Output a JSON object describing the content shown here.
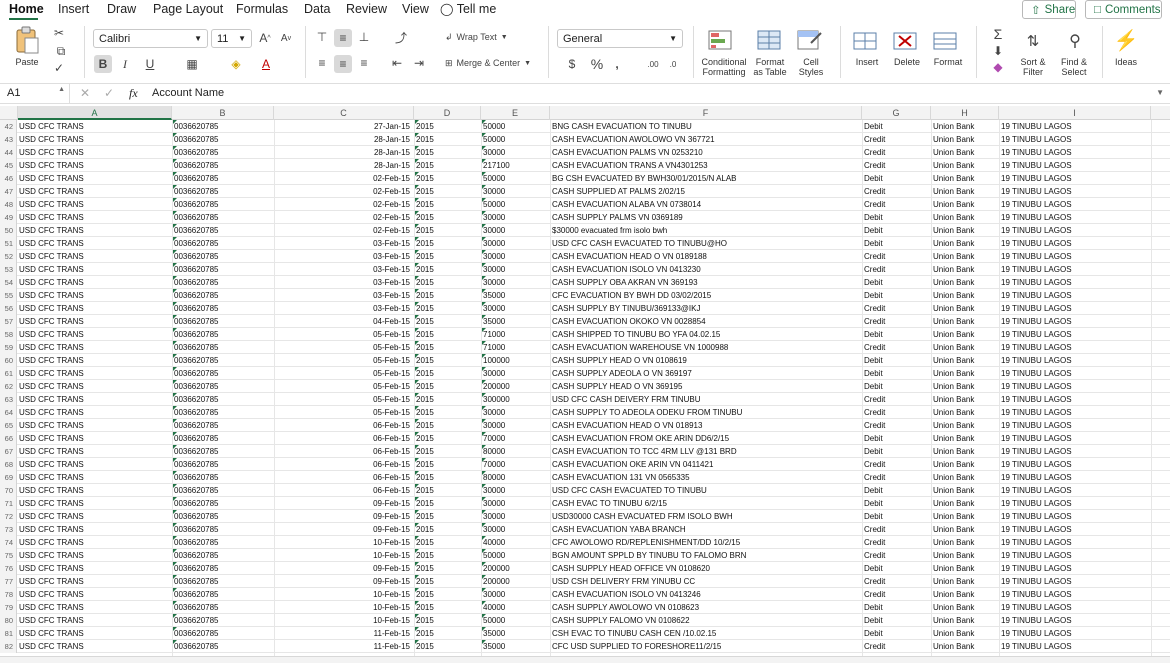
{
  "tabs": [
    "Home",
    "Insert",
    "Draw",
    "Page Layout",
    "Formulas",
    "Data",
    "Review",
    "View"
  ],
  "tell_me": "Tell me",
  "share_label": "Share",
  "comments_label": "Comments",
  "accent_color": "#217346",
  "ribbon": {
    "paste_label": "Paste",
    "font_name": "Calibri",
    "font_size": "11",
    "wrap_text_label": "Wrap Text",
    "merge_center_label": "Merge & Center",
    "number_format": "General",
    "conditional_formatting_label": [
      "Conditional",
      "Formatting"
    ],
    "format_table_label": [
      "Format",
      "as Table"
    ],
    "cell_styles_label": [
      "Cell",
      "Styles"
    ],
    "insert_label": "Insert",
    "delete_label": "Delete",
    "format_label": "Format",
    "sort_filter_label": [
      "Sort &",
      "Filter"
    ],
    "find_select_label": [
      "Find &",
      "Select"
    ],
    "ideas_label": "Ideas"
  },
  "formula_bar": {
    "name_box": "A1",
    "fx": "fx",
    "content": "Account Name"
  },
  "columns": [
    "A",
    "B",
    "C",
    "D",
    "E",
    "F",
    "G",
    "H",
    "I"
  ],
  "rows": [
    {
      "n": "42",
      "a": "USD CFC TRANS",
      "b": "0036620785",
      "c": "27-Jan-15",
      "d": "2015",
      "e": "50000",
      "f": "BNG CASH EVACUATION TO TINUBU",
      "g": "Debit",
      "h": "Union Bank",
      "i": "19 TINUBU LAGOS"
    },
    {
      "n": "43",
      "a": "USD CFC TRANS",
      "b": "0036620785",
      "c": "28-Jan-15",
      "d": "2015",
      "e": "50000",
      "f": "CASH EVACUATION AWOLOWO VN 367721",
      "g": "Credit",
      "h": "Union Bank",
      "i": "19 TINUBU LAGOS"
    },
    {
      "n": "44",
      "a": "USD CFC TRANS",
      "b": "0036620785",
      "c": "28-Jan-15",
      "d": "2015",
      "e": "30000",
      "f": "CASH EVACUATION PALMS VN 0253210",
      "g": "Credit",
      "h": "Union Bank",
      "i": "19 TINUBU LAGOS"
    },
    {
      "n": "45",
      "a": "USD CFC TRANS",
      "b": "0036620785",
      "c": "28-Jan-15",
      "d": "2015",
      "e": "217100",
      "f": "CASH EVACUATION TRANS A VN4301253",
      "g": "Credit",
      "h": "Union Bank",
      "i": "19 TINUBU LAGOS"
    },
    {
      "n": "46",
      "a": "USD CFC TRANS",
      "b": "0036620785",
      "c": "02-Feb-15",
      "d": "2015",
      "e": "50000",
      "f": "BG CSH EVACUATED BY BWH30/01/2015/N ALAB",
      "g": "Debit",
      "h": "Union Bank",
      "i": "19 TINUBU LAGOS"
    },
    {
      "n": "47",
      "a": "USD CFC TRANS",
      "b": "0036620785",
      "c": "02-Feb-15",
      "d": "2015",
      "e": "30000",
      "f": "CASH SUPPLIED AT PALMS 2/02/15",
      "g": "Credit",
      "h": "Union Bank",
      "i": "19 TINUBU LAGOS"
    },
    {
      "n": "48",
      "a": "USD CFC TRANS",
      "b": "0036620785",
      "c": "02-Feb-15",
      "d": "2015",
      "e": "50000",
      "f": "CASH EVACUATION ALABA VN 0738014",
      "g": "Credit",
      "h": "Union Bank",
      "i": "19 TINUBU LAGOS"
    },
    {
      "n": "49",
      "a": "USD CFC TRANS",
      "b": "0036620785",
      "c": "02-Feb-15",
      "d": "2015",
      "e": "30000",
      "f": "CASH SUPPLY PALMS VN 0369189",
      "g": "Debit",
      "h": "Union Bank",
      "i": "19 TINUBU LAGOS"
    },
    {
      "n": "50",
      "a": "USD CFC TRANS",
      "b": "0036620785",
      "c": "02-Feb-15",
      "d": "2015",
      "e": "30000",
      "f": "$30000 evacuated frm isolo bwh",
      "g": "Debit",
      "h": "Union Bank",
      "i": "19 TINUBU LAGOS"
    },
    {
      "n": "51",
      "a": "USD CFC TRANS",
      "b": "0036620785",
      "c": "03-Feb-15",
      "d": "2015",
      "e": "30000",
      "f": "USD CFC CASH EVACUATED TO TINUBU@HO",
      "g": "Debit",
      "h": "Union Bank",
      "i": "19 TINUBU LAGOS"
    },
    {
      "n": "52",
      "a": "USD CFC TRANS",
      "b": "0036620785",
      "c": "03-Feb-15",
      "d": "2015",
      "e": "30000",
      "f": "CASH EVACUATION HEAD O VN 0189188",
      "g": "Credit",
      "h": "Union Bank",
      "i": "19 TINUBU LAGOS"
    },
    {
      "n": "53",
      "a": "USD CFC TRANS",
      "b": "0036620785",
      "c": "03-Feb-15",
      "d": "2015",
      "e": "30000",
      "f": "CASH EVACUATION ISOLO VN 0413230",
      "g": "Credit",
      "h": "Union Bank",
      "i": "19 TINUBU LAGOS"
    },
    {
      "n": "54",
      "a": "USD CFC TRANS",
      "b": "0036620785",
      "c": "03-Feb-15",
      "d": "2015",
      "e": "30000",
      "f": "CASH SUPPLY OBA AKRAN VN 369193",
      "g": "Debit",
      "h": "Union Bank",
      "i": "19 TINUBU LAGOS"
    },
    {
      "n": "55",
      "a": "USD CFC TRANS",
      "b": "0036620785",
      "c": "03-Feb-15",
      "d": "2015",
      "e": "35000",
      "f": "CFC EVACUATION BY BWH DD 03/02/2015",
      "g": "Debit",
      "h": "Union Bank",
      "i": "19 TINUBU LAGOS"
    },
    {
      "n": "56",
      "a": "USD CFC TRANS",
      "b": "0036620785",
      "c": "03-Feb-15",
      "d": "2015",
      "e": "30000",
      "f": "CASH SUPPLY BY TINUBU/369133@IKJ",
      "g": "Credit",
      "h": "Union Bank",
      "i": "19 TINUBU LAGOS"
    },
    {
      "n": "57",
      "a": "USD CFC TRANS",
      "b": "0036620785",
      "c": "04-Feb-15",
      "d": "2015",
      "e": "35000",
      "f": "CASH EVACUATION OKOKO VN 0028854",
      "g": "Credit",
      "h": "Union Bank",
      "i": "19 TINUBU LAGOS"
    },
    {
      "n": "58",
      "a": "USD CFC TRANS",
      "b": "0036620785",
      "c": "05-Feb-15",
      "d": "2015",
      "e": "71000",
      "f": "CASH SHIPPED TO TINUBU BO YFA 04.02.15",
      "g": "Debit",
      "h": "Union Bank",
      "i": "19 TINUBU LAGOS"
    },
    {
      "n": "59",
      "a": "USD CFC TRANS",
      "b": "0036620785",
      "c": "05-Feb-15",
      "d": "2015",
      "e": "71000",
      "f": "CASH EVACUATION WAREHOUSE VN 1000988",
      "g": "Credit",
      "h": "Union Bank",
      "i": "19 TINUBU LAGOS"
    },
    {
      "n": "60",
      "a": "USD CFC TRANS",
      "b": "0036620785",
      "c": "05-Feb-15",
      "d": "2015",
      "e": "100000",
      "f": "CASH SUPPLY HEAD O VN 0108619",
      "g": "Debit",
      "h": "Union Bank",
      "i": "19 TINUBU LAGOS"
    },
    {
      "n": "61",
      "a": "USD CFC TRANS",
      "b": "0036620785",
      "c": "05-Feb-15",
      "d": "2015",
      "e": "30000",
      "f": "CASH SUPPLY ADEOLA O VN 369197",
      "g": "Debit",
      "h": "Union Bank",
      "i": "19 TINUBU LAGOS"
    },
    {
      "n": "62",
      "a": "USD CFC TRANS",
      "b": "0036620785",
      "c": "05-Feb-15",
      "d": "2015",
      "e": "200000",
      "f": "CASH SUPPLY HEAD O VN 369195",
      "g": "Debit",
      "h": "Union Bank",
      "i": "19 TINUBU LAGOS"
    },
    {
      "n": "63",
      "a": "USD CFC TRANS",
      "b": "0036620785",
      "c": "05-Feb-15",
      "d": "2015",
      "e": "300000",
      "f": "USD CFC CASH DEIVERY FRM TINUBU",
      "g": "Credit",
      "h": "Union Bank",
      "i": "19 TINUBU LAGOS"
    },
    {
      "n": "64",
      "a": "USD CFC TRANS",
      "b": "0036620785",
      "c": "05-Feb-15",
      "d": "2015",
      "e": "30000",
      "f": "CASH SUPPLY TO ADEOLA ODEKU FROM TINUBU",
      "g": "Credit",
      "h": "Union Bank",
      "i": "19 TINUBU LAGOS"
    },
    {
      "n": "65",
      "a": "USD CFC TRANS",
      "b": "0036620785",
      "c": "06-Feb-15",
      "d": "2015",
      "e": "30000",
      "f": "CASH EVACUATION HEAD O VN 018913",
      "g": "Credit",
      "h": "Union Bank",
      "i": "19 TINUBU LAGOS"
    },
    {
      "n": "66",
      "a": "USD CFC TRANS",
      "b": "0036620785",
      "c": "06-Feb-15",
      "d": "2015",
      "e": "70000",
      "f": "CASH EVACUATION FROM OKE ARIN DD6/2/15",
      "g": "Debit",
      "h": "Union Bank",
      "i": "19 TINUBU LAGOS"
    },
    {
      "n": "67",
      "a": "USD CFC TRANS",
      "b": "0036620785",
      "c": "06-Feb-15",
      "d": "2015",
      "e": "80000",
      "f": "CASH EVACUATION TO TCC 4RM LLV @131 BRD",
      "g": "Debit",
      "h": "Union Bank",
      "i": "19 TINUBU LAGOS"
    },
    {
      "n": "68",
      "a": "USD CFC TRANS",
      "b": "0036620785",
      "c": "06-Feb-15",
      "d": "2015",
      "e": "70000",
      "f": "CASH EVACUATION OKE ARIN VN 0411421",
      "g": "Credit",
      "h": "Union Bank",
      "i": "19 TINUBU LAGOS"
    },
    {
      "n": "69",
      "a": "USD CFC TRANS",
      "b": "0036620785",
      "c": "06-Feb-15",
      "d": "2015",
      "e": "80000",
      "f": "CASH EVACUATION 131 VN 0565335",
      "g": "Credit",
      "h": "Union Bank",
      "i": "19 TINUBU LAGOS"
    },
    {
      "n": "70",
      "a": "USD CFC TRANS",
      "b": "0036620785",
      "c": "06-Feb-15",
      "d": "2015",
      "e": "30000",
      "f": "USD CFC CASH EVACUATED TO TINUBU",
      "g": "Debit",
      "h": "Union Bank",
      "i": "19 TINUBU LAGOS"
    },
    {
      "n": "71",
      "a": "USD CFC TRANS",
      "b": "0036620785",
      "c": "09-Feb-15",
      "d": "2015",
      "e": "30000",
      "f": "CASH EVAC TO TINUBU 6/2/15",
      "g": "Debit",
      "h": "Union Bank",
      "i": "19 TINUBU LAGOS"
    },
    {
      "n": "72",
      "a": "USD CFC TRANS",
      "b": "0036620785",
      "c": "09-Feb-15",
      "d": "2015",
      "e": "30000",
      "f": "USD30000 CASH EVACUATED FRM ISOLO BWH",
      "g": "Debit",
      "h": "Union Bank",
      "i": "19 TINUBU LAGOS"
    },
    {
      "n": "73",
      "a": "USD CFC TRANS",
      "b": "0036620785",
      "c": "09-Feb-15",
      "d": "2015",
      "e": "30000",
      "f": "CASH EVACUATION YABA BRANCH",
      "g": "Credit",
      "h": "Union Bank",
      "i": "19 TINUBU LAGOS"
    },
    {
      "n": "74",
      "a": "USD CFC TRANS",
      "b": "0036620785",
      "c": "10-Feb-15",
      "d": "2015",
      "e": "40000",
      "f": "CFC AWOLOWO RD/REPLENISHMENT/DD 10/2/15",
      "g": "Credit",
      "h": "Union Bank",
      "i": "19 TINUBU LAGOS"
    },
    {
      "n": "75",
      "a": "USD CFC TRANS",
      "b": "0036620785",
      "c": "10-Feb-15",
      "d": "2015",
      "e": "50000",
      "f": "BGN AMOUNT SPPLD BY TINUBU TO FALOMO BRN",
      "g": "Credit",
      "h": "Union Bank",
      "i": "19 TINUBU LAGOS"
    },
    {
      "n": "76",
      "a": "USD CFC TRANS",
      "b": "0036620785",
      "c": "09-Feb-15",
      "d": "2015",
      "e": "200000",
      "f": "CASH SUPPLY HEAD OFFICE VN 0108620",
      "g": "Debit",
      "h": "Union Bank",
      "i": "19 TINUBU LAGOS"
    },
    {
      "n": "77",
      "a": "USD CFC TRANS",
      "b": "0036620785",
      "c": "09-Feb-15",
      "d": "2015",
      "e": "200000",
      "f": "USD CSH DELIVERY FRM YINUBU CC",
      "g": "Credit",
      "h": "Union Bank",
      "i": "19 TINUBU LAGOS"
    },
    {
      "n": "78",
      "a": "USD CFC TRANS",
      "b": "0036620785",
      "c": "10-Feb-15",
      "d": "2015",
      "e": "30000",
      "f": "CASH EVACUATION ISOLO VN 0413246",
      "g": "Credit",
      "h": "Union Bank",
      "i": "19 TINUBU LAGOS"
    },
    {
      "n": "79",
      "a": "USD CFC TRANS",
      "b": "0036620785",
      "c": "10-Feb-15",
      "d": "2015",
      "e": "40000",
      "f": "CASH SUPPLY AWOLOWO VN 0108623",
      "g": "Debit",
      "h": "Union Bank",
      "i": "19 TINUBU LAGOS"
    },
    {
      "n": "80",
      "a": "USD CFC TRANS",
      "b": "0036620785",
      "c": "10-Feb-15",
      "d": "2015",
      "e": "50000",
      "f": "CASH SUPPLY FALOMO VN 0108622",
      "g": "Debit",
      "h": "Union Bank",
      "i": "19 TINUBU LAGOS"
    },
    {
      "n": "81",
      "a": "USD CFC TRANS",
      "b": "0036620785",
      "c": "11-Feb-15",
      "d": "2015",
      "e": "35000",
      "f": "CSH EVAC TO TINUBU CASH CEN /10.02.15",
      "g": "Debit",
      "h": "Union Bank",
      "i": "19 TINUBU LAGOS"
    },
    {
      "n": "82",
      "a": "USD CFC TRANS",
      "b": "0036620785",
      "c": "11-Feb-15",
      "d": "2015",
      "e": "35000",
      "f": "CFC USD SUPPLIED TO FORESHORE11/2/15",
      "g": "Credit",
      "h": "Union Bank",
      "i": "19 TINUBU LAGOS"
    }
  ]
}
